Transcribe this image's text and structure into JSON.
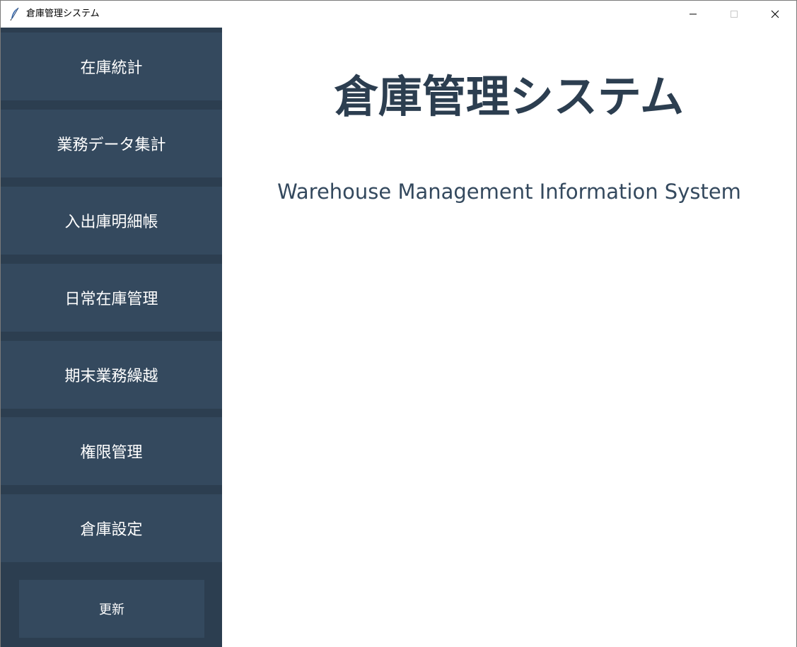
{
  "window": {
    "title": "倉庫管理システム",
    "icons": {
      "app": "feather-icon",
      "minimize": "minimize-icon",
      "maximize": "maximize-icon",
      "close": "close-icon"
    }
  },
  "sidebar": {
    "items": [
      {
        "label": "在庫統計"
      },
      {
        "label": "業務データ集計"
      },
      {
        "label": "入出庫明細帳"
      },
      {
        "label": "日常在庫管理"
      },
      {
        "label": "期末業務繰越"
      },
      {
        "label": "権限管理"
      },
      {
        "label": "倉庫設定"
      }
    ],
    "refresh_label": "更新"
  },
  "main": {
    "title": "倉庫管理システム",
    "subtitle": "Warehouse Management Information System"
  },
  "colors": {
    "sidebar_bg": "#2c3e50",
    "button_bg": "#34495e",
    "title_color": "#2c3e50",
    "text_light": "#ffffff"
  }
}
